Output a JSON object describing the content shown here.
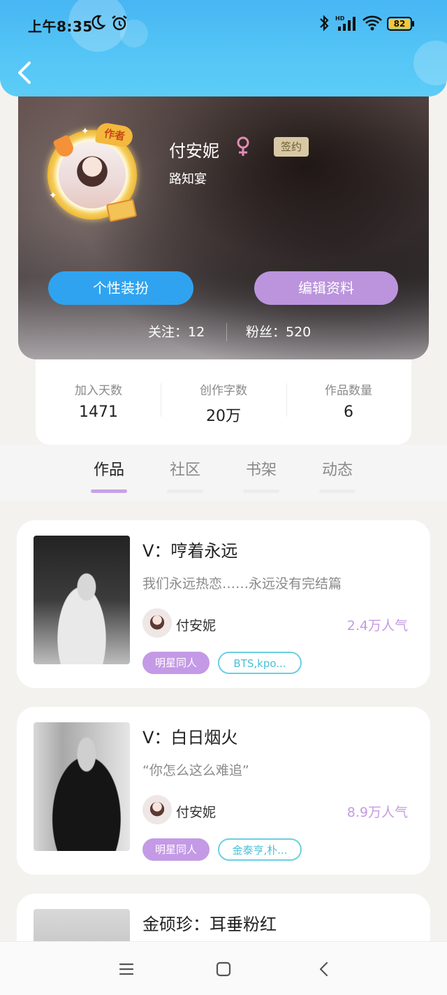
{
  "status_bar": {
    "time": "上午8:35",
    "battery": "82"
  },
  "profile": {
    "author_badge": "作者",
    "name": "付安妮",
    "sign_badge": "签约",
    "pen_name": "路知宴",
    "dress_button": "个性装扮",
    "edit_button": "编辑资料",
    "follow_text": "关注：12",
    "fans_text": "粉丝：520"
  },
  "stats": [
    {
      "label": "加入天数",
      "value": "1471"
    },
    {
      "label": "创作字数",
      "value": "20万"
    },
    {
      "label": "作品数量",
      "value": "6"
    }
  ],
  "tabs": [
    {
      "label": "作品",
      "active": true
    },
    {
      "label": "社区",
      "active": false
    },
    {
      "label": "书架",
      "active": false
    },
    {
      "label": "动态",
      "active": false
    }
  ],
  "works": [
    {
      "title": "V：哼着永远",
      "desc": "我们永远热恋……永远没有完结篇",
      "author": "付安妮",
      "popularity": "2.4万人气",
      "tags": [
        "明星同人",
        "BTS,kpo..."
      ]
    },
    {
      "title": "V：白日烟火",
      "desc": "“你怎么这么难追”",
      "author": "付安妮",
      "popularity": "8.9万人气",
      "tags": [
        "明星同人",
        "金泰亨,朴..."
      ]
    },
    {
      "title": "金硕珍：耳垂粉红",
      "desc": "",
      "author": "",
      "popularity": "",
      "tags": []
    }
  ],
  "colors": {
    "topbar": "#4fbff5",
    "accent_blue": "#2fa3f0",
    "accent_purple": "#bb94dd",
    "tag_cyan": "#4ac0d6"
  }
}
